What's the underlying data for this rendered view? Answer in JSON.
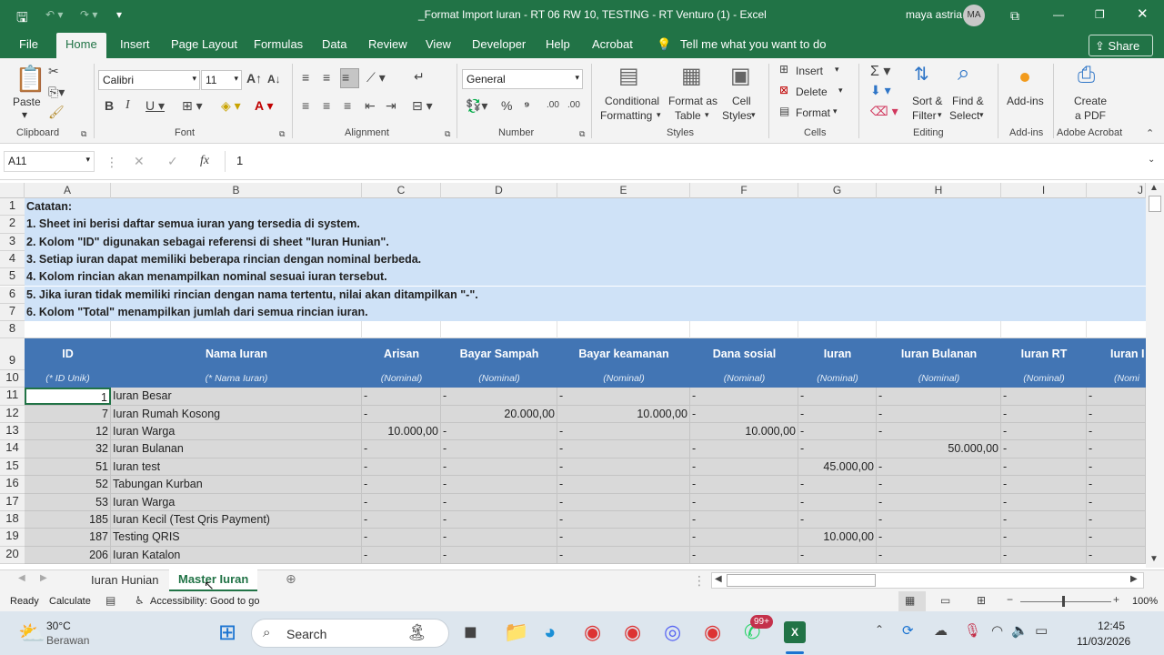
{
  "titlebar": {
    "title": "_Format Import Iuran - RT 06 RW 10, TESTING - RT Venturo (1)  -  Excel",
    "user": "maya astria",
    "avatar": "MA"
  },
  "menu": [
    "File",
    "Home",
    "Insert",
    "Page Layout",
    "Formulas",
    "Data",
    "Review",
    "View",
    "Developer",
    "Help",
    "Acrobat"
  ],
  "tell_me": "Tell me what you want to do",
  "share": "Share",
  "ribbon": {
    "paste": "Paste",
    "font_name": "Calibri",
    "font_size": "11",
    "number_format": "General",
    "conditional": [
      "Conditional",
      "Formatting"
    ],
    "format_as": [
      "Format as",
      "Table"
    ],
    "cell_styles": [
      "Cell",
      "Styles"
    ],
    "insert": "Insert",
    "delete": "Delete",
    "format": "Format",
    "sort": [
      "Sort &",
      "Filter"
    ],
    "find": [
      "Find &",
      "Select"
    ],
    "addins": "Add-ins",
    "pdf": [
      "Create",
      "a PDF"
    ],
    "groups": [
      "Clipboard",
      "Font",
      "Alignment",
      "Number",
      "Styles",
      "Cells",
      "Editing",
      "Add-ins",
      "Adobe Acrobat"
    ]
  },
  "formula": {
    "name_box": "A11",
    "fx": "fx",
    "value": "1"
  },
  "columns": [
    "A",
    "B",
    "C",
    "D",
    "E",
    "F",
    "G",
    "H",
    "I",
    "J"
  ],
  "rows": [
    "1",
    "2",
    "3",
    "4",
    "5",
    "6",
    "7",
    "8",
    "9",
    "10",
    "11",
    "12",
    "13",
    "14",
    "15",
    "16",
    "17",
    "18",
    "19",
    "20"
  ],
  "notes": [
    "Catatan:",
    "1. Sheet ini berisi daftar semua iuran yang tersedia di system.",
    "2. Kolom \"ID\" digunakan sebagai referensi di sheet \"Iuran Hunian\".",
    "3. Setiap iuran dapat memiliki beberapa rincian dengan nominal berbeda.",
    "4. Kolom rincian akan menampilkan nominal sesuai iuran tersebut.",
    "5. Jika iuran tidak memiliki rincian dengan nama tertentu, nilai akan ditampilkan \"-\".",
    "6. Kolom \"Total\" menampilkan jumlah dari semua rincian iuran."
  ],
  "header": [
    "ID",
    "Nama Iuran",
    "Arisan",
    "Bayar Sampah",
    "Bayar keamanan",
    "Dana sosial",
    "Iuran",
    "Iuran Bulanan",
    "Iuran RT",
    "Iuran I"
  ],
  "subheader": [
    "(* ID Unik)",
    "(* Nama Iuran)",
    "(Nominal)",
    "(Nominal)",
    "(Nominal)",
    "(Nominal)",
    "(Nominal)",
    "(Nominal)",
    "(Nominal)",
    "(Nomi"
  ],
  "data": [
    [
      "1",
      "Iuran Besar",
      "-",
      "-",
      "-",
      "-",
      "-",
      "-",
      "-",
      "-"
    ],
    [
      "7",
      "Iuran Rumah Kosong",
      "-",
      "20.000,00",
      "10.000,00",
      "-",
      "-",
      "-",
      "-",
      "-"
    ],
    [
      "12",
      "Iuran Warga",
      "10.000,00",
      "-",
      "-",
      "10.000,00",
      "-",
      "-",
      "-",
      "-"
    ],
    [
      "32",
      "Iuran Bulanan",
      "-",
      "-",
      "-",
      "-",
      "-",
      "50.000,00",
      "-",
      "-"
    ],
    [
      "51",
      "Iuran test",
      "-",
      "-",
      "-",
      "-",
      "45.000,00",
      "-",
      "-",
      "-"
    ],
    [
      "52",
      "Tabungan Kurban",
      "-",
      "-",
      "-",
      "-",
      "-",
      "-",
      "-",
      "-"
    ],
    [
      "53",
      "Iuran Warga",
      "-",
      "-",
      "-",
      "-",
      "-",
      "-",
      "-",
      "-"
    ],
    [
      "185",
      "Iuran Kecil (Test Qris Payment)",
      "-",
      "-",
      "-",
      "-",
      "-",
      "-",
      "-",
      "-"
    ],
    [
      "187",
      "Testing QRIS",
      "-",
      "-",
      "-",
      "-",
      "10.000,00",
      "-",
      "-",
      "-"
    ],
    [
      "206",
      "Iuran Katalon",
      "-",
      "-",
      "-",
      "-",
      "-",
      "-",
      "-",
      "-"
    ]
  ],
  "sheets": [
    "Iuran Hunian",
    "Master Iuran"
  ],
  "status": {
    "ready": "Ready",
    "calculate": "Calculate",
    "accessibility": "Accessibility: Good to go",
    "zoom": "100%"
  },
  "taskbar": {
    "temp": "30°C",
    "weather": "Berawan",
    "search": "Search",
    "badge": "99+",
    "time": "12:45",
    "date": "11/03/2026"
  },
  "colors": {
    "excel_green": "#217346",
    "header_blue": "#4275b4",
    "note_blue": "#cfe2f7",
    "row_gray": "#d9d9d9"
  }
}
